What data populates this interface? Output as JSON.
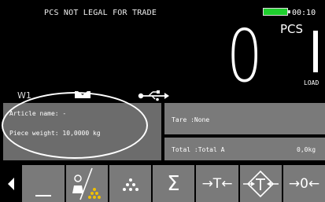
{
  "header": {
    "legal_notice": "PCS NOT LEGAL FOR TRADE",
    "time": "00:10",
    "battery_color": "#1fcf2e"
  },
  "display": {
    "unit": "PCS",
    "value": "0",
    "load_label": "LOAD",
    "scale_label": "W1"
  },
  "info": {
    "article_name": "Article name: -",
    "piece_weight": "Piece weight: 10,0000 kg",
    "tare": "Tare :None",
    "total": "Total :Total A",
    "total_weight": "0,0kg"
  },
  "toolbar": {
    "sum_label": "Σ",
    "tare_label": "→T←",
    "zero_label": "→0←"
  }
}
